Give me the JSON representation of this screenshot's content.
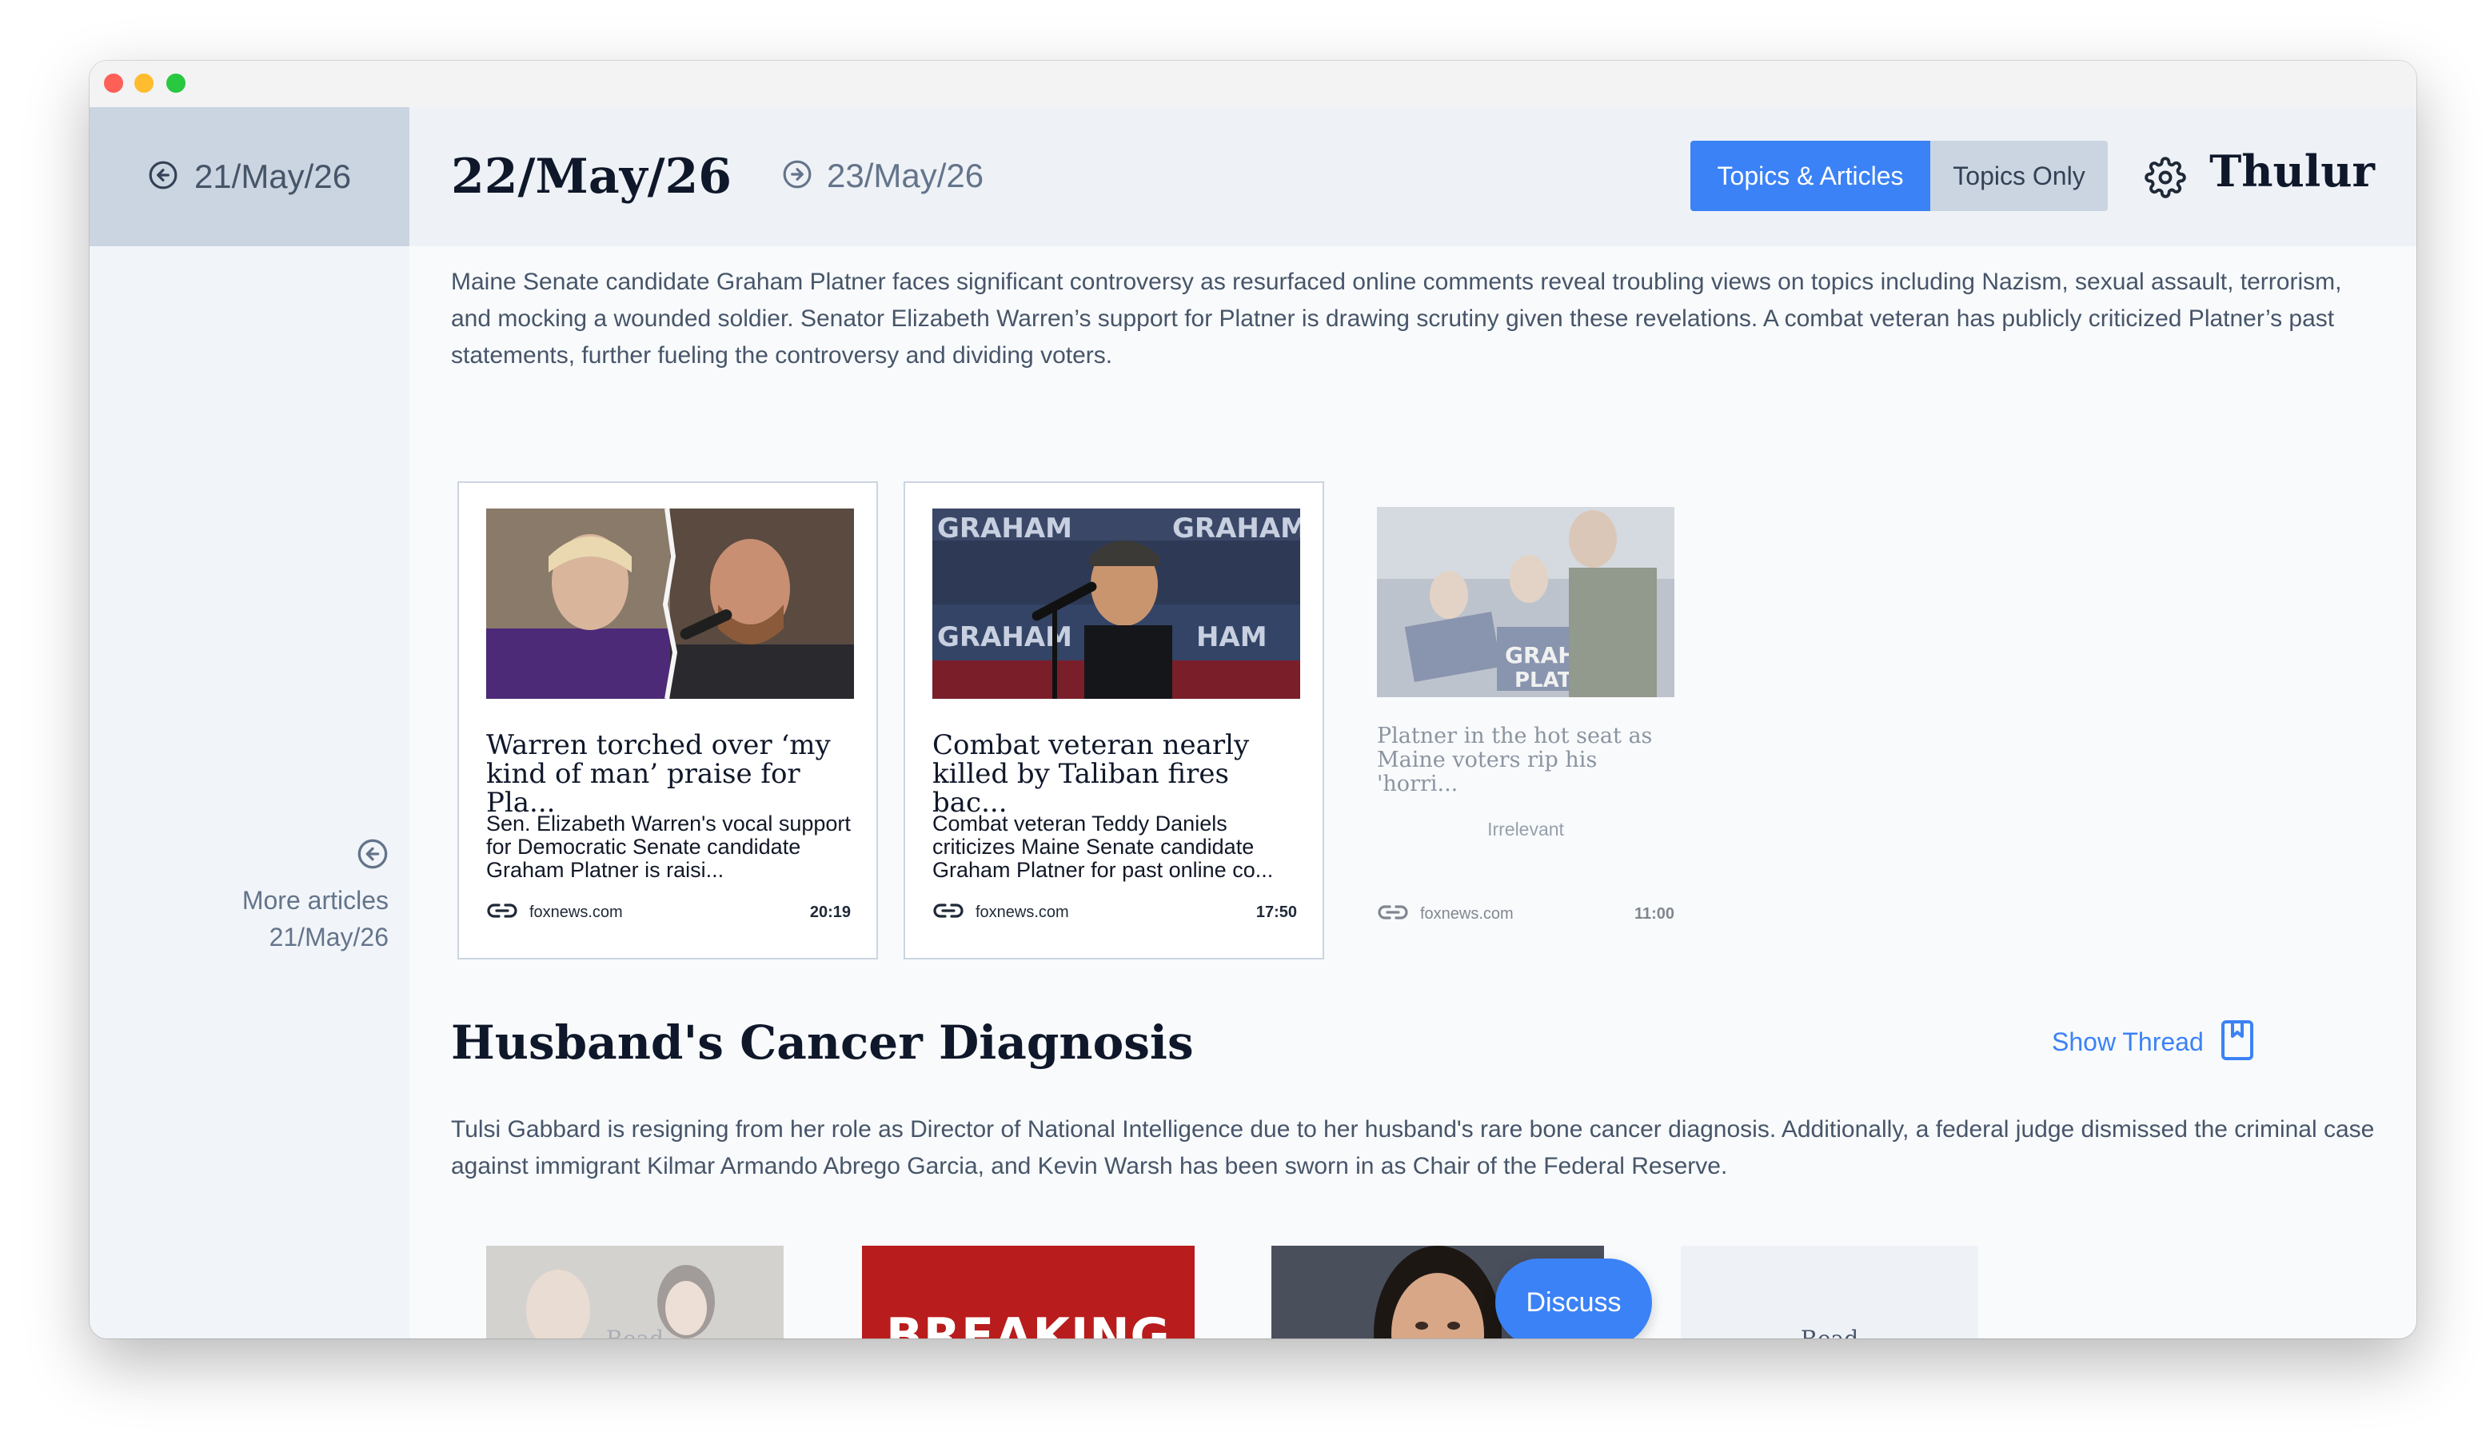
{
  "nav": {
    "prev_day": "21/May/26",
    "current_day": "22/May/26",
    "next_day": "23/May/26",
    "more_articles_label": "More articles",
    "more_articles_date": "21/May/26"
  },
  "view_toggle": {
    "options": [
      "Topics & Articles",
      "Topics Only"
    ],
    "selected": "Topics & Articles"
  },
  "brand": "Thulur",
  "topic1": {
    "summary": "Maine Senate candidate Graham Platner faces significant controversy as resurfaced online comments reveal troubling views on topics including Nazism, sexual assault, terrorism, and mocking a wounded soldier. Senator Elizabeth Warren’s support for Platner is drawing scrutiny given these revelations. A combat veteran has publicly criticized Platner’s past statements, further fueling the controversy and dividing voters.",
    "articles": [
      {
        "title": "Warren torched over ‘my kind of man’ praise for Pla...",
        "description": "Sen. Elizabeth Warren's vocal support for Democratic Senate candidate Graham Platner is raisi...",
        "source": "foxnews.com",
        "time": "20:19"
      },
      {
        "title": "Combat veteran nearly killed by Taliban fires bac...",
        "description": "Combat veteran Teddy Daniels criticizes Maine Senate candidate Graham Platner for past online co...",
        "source": "foxnews.com",
        "time": "17:50"
      },
      {
        "title": "Platner in the hot seat as Maine voters rip his 'horri...",
        "status": "Irrelevant",
        "source": "foxnews.com",
        "time": "11:00"
      }
    ]
  },
  "topic2": {
    "title": "Husband's Cancer Diagnosis",
    "show_thread_label": "Show Thread",
    "summary": "Tulsi Gabbard is resigning from her role as Director of National Intelligence due to her husband's rare bone cancer diagnosis. Additionally, a federal judge dismissed the criminal case against immigrant Kilmar Armando Abrego Garcia, and Kevin Warsh has been sworn in as Chair of the Federal Reserve.",
    "thumbs": {
      "read_label": "Read",
      "breaking_text": "BREAKING"
    }
  },
  "discuss_label": "Discuss",
  "colors": {
    "accent": "#3b82f6",
    "breaking": "#b91c1c",
    "sidebar_prev": "#cbd5e1"
  },
  "icons": [
    "arrow-left-circle-icon",
    "arrow-right-circle-icon",
    "gear-icon",
    "bookmark-icon",
    "chevron-up-icon",
    "link-icon"
  ]
}
